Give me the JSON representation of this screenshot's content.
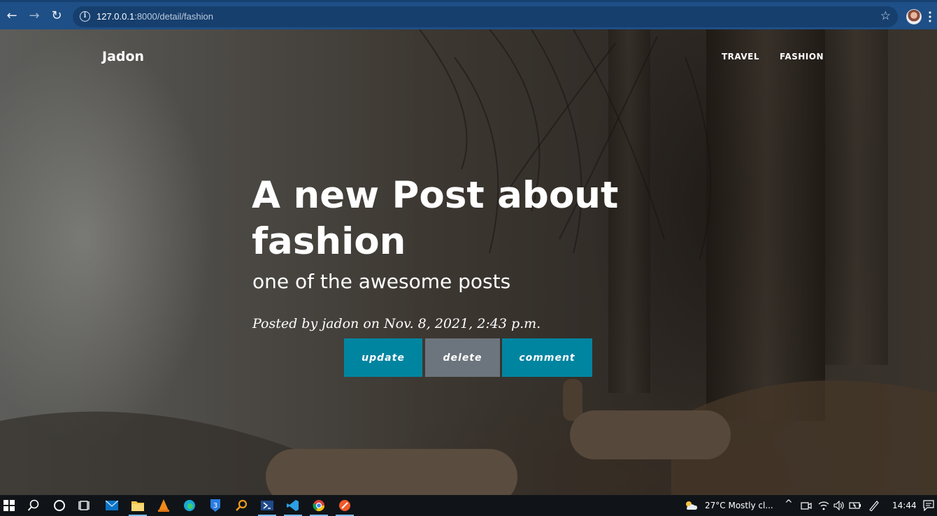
{
  "browser": {
    "url_host": "127.0.0.1",
    "url_rest": ":8000/detail/fashion",
    "icons": [
      "back-arrow-icon",
      "forward-arrow-icon",
      "reload-icon",
      "info-icon",
      "star-icon",
      "profile-avatar"
    ]
  },
  "site": {
    "brand": "Jadon",
    "nav": [
      {
        "label": "TRAVEL"
      },
      {
        "label": "FASHION"
      }
    ]
  },
  "post": {
    "title": "A new Post about fashion",
    "subtitle": "one of the awesome posts",
    "meta": "Posted by jadon on Nov. 8, 2021, 2:43 p.m.",
    "actions": {
      "update": "update",
      "delete": "delete",
      "comment": "comment"
    }
  },
  "colors": {
    "chrome": "#1e4f86",
    "primary_button": "#0085a1",
    "secondary_button": "#6c757d",
    "taskbar": "#101418"
  },
  "taskbar": {
    "weather": "27°C  Mostly cl...",
    "time": "14:44",
    "pinned": [
      "start-icon",
      "search-icon",
      "cortana-icon",
      "task-view-icon",
      "mail-icon",
      "file-explorer-icon",
      "vlc-icon",
      "edge-icon",
      "app-3-icon",
      "search-app-icon",
      "powershell-icon",
      "vscode-icon",
      "chrome-icon",
      "app-red-icon"
    ]
  }
}
